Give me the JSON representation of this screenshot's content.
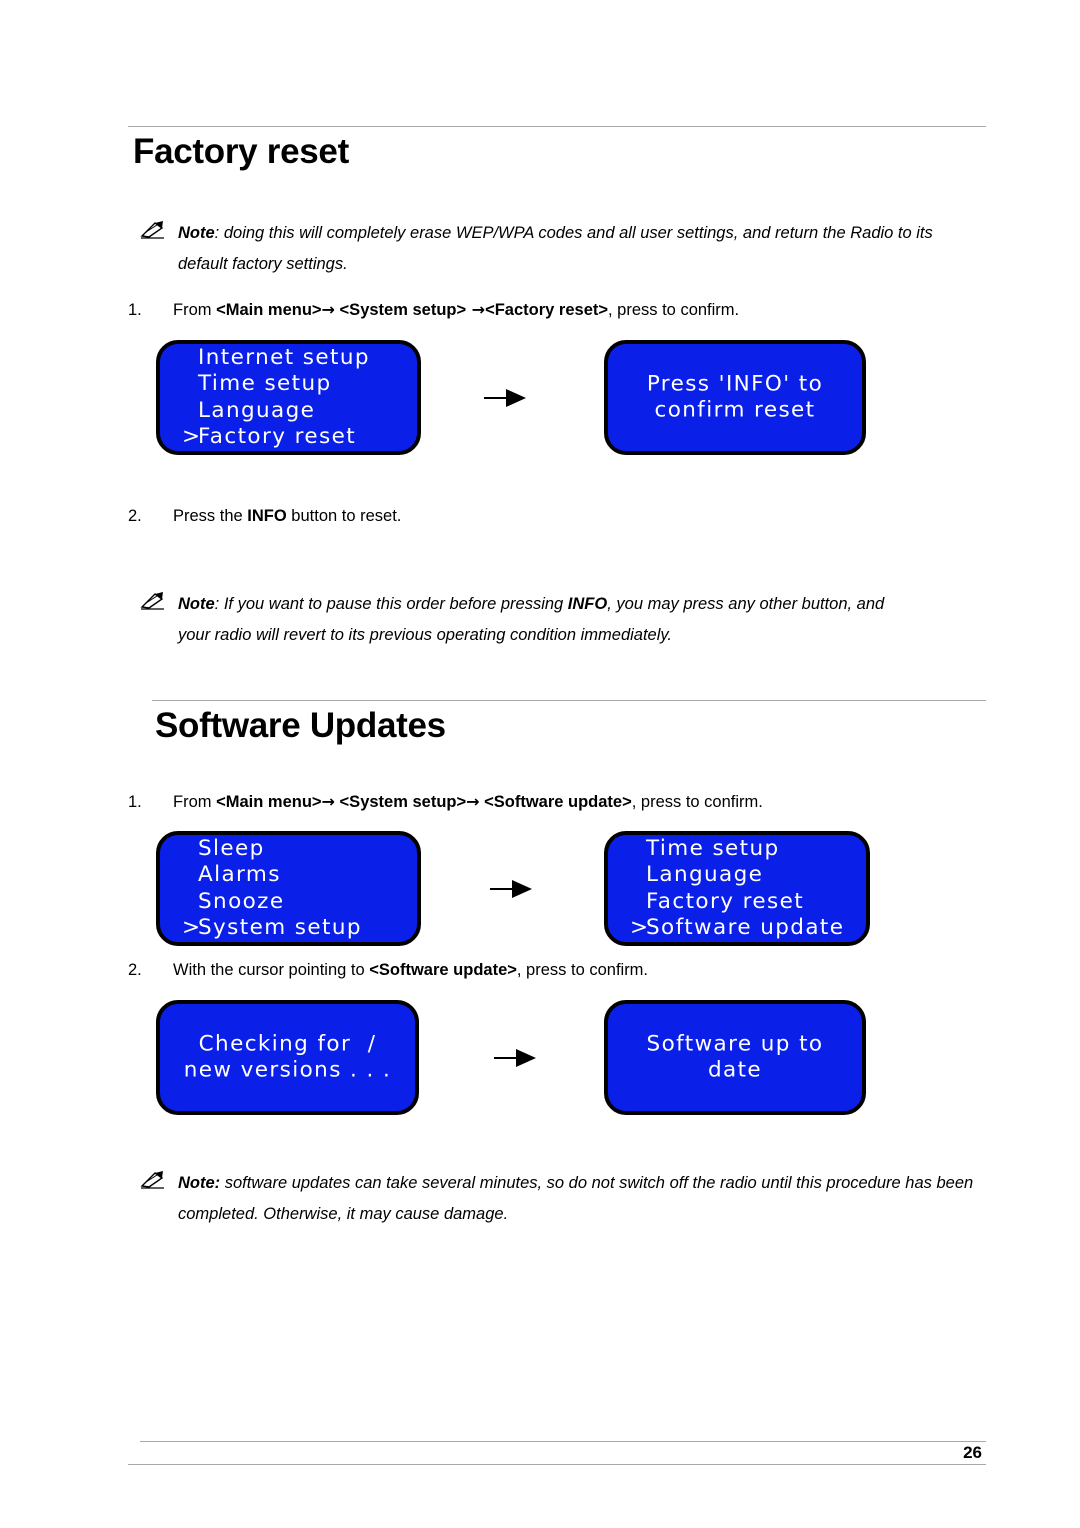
{
  "document": {
    "page_number": "26"
  },
  "sections": [
    {
      "id": "factory-reset",
      "title": "Factory reset",
      "note_top": {
        "icon": "note-pen-icon",
        "label": "Note",
        "separator": ":",
        "text": " doing this will completely erase WEP/WPA codes and all user settings, and return the Radio to its default factory settings."
      },
      "step1": {
        "number": "1.",
        "prefix": "From ",
        "item1": "<Main menu>",
        "arrow1": "→",
        "gap1": " ",
        "item2": "<System setup>",
        "arrow2": " →",
        "item3": "<Factory reset>",
        "suffix": ", press to confirm."
      },
      "step2": {
        "number": "2.",
        "prefix": "Press the ",
        "bold": "INFO",
        "suffix": " button to reset."
      },
      "note_bottom": {
        "icon": "note-pen-icon",
        "label": "Note",
        "separator": ":",
        "text_before": " If you want to pause this order before pressing ",
        "bold": "INFO",
        "text_after": ", you may press any other button, and your radio will revert to its previous operating condition immediately."
      }
    },
    {
      "id": "software-updates",
      "title": "Software Updates",
      "step1": {
        "number": "1.",
        "prefix": "From ",
        "item1": "<Main menu>",
        "arrow1": "→",
        "gap1": " ",
        "item2": "<System setup>",
        "arrow2": "→",
        "gap2": " ",
        "item3": "<Software update>",
        "suffix": ", press to confirm."
      },
      "step2": {
        "number": "2.",
        "prefix": "With the cursor pointing to ",
        "bold": "<Software update>",
        "suffix": ", press to confirm."
      },
      "note_bottom": {
        "icon": "note-pen-icon",
        "label": "Note:",
        "separator": "",
        "text": "  software updates can take several minutes, so do not switch off the radio until this procedure has been completed. Otherwise, it may cause damage."
      }
    }
  ],
  "lcd_screens": {
    "colors": {
      "background": "#0a1fe8",
      "border": "#000000",
      "text": "#ffffff"
    },
    "fr_menu": {
      "name": "system-setup-menu",
      "align": "left",
      "lines": [
        {
          "cursor": "",
          "text": "Internet setup"
        },
        {
          "cursor": "",
          "text": "Time setup"
        },
        {
          "cursor": "",
          "text": "Language"
        },
        {
          "cursor": ">",
          "text": "Factory reset"
        }
      ]
    },
    "fr_confirm": {
      "name": "confirm-reset-message",
      "align": "center",
      "lines": [
        {
          "cursor": "",
          "text": "Press 'INFO' to"
        },
        {
          "cursor": "",
          "text": "confirm reset"
        }
      ]
    },
    "su_main_menu": {
      "name": "main-menu",
      "align": "left",
      "lines": [
        {
          "cursor": "",
          "text": "Sleep"
        },
        {
          "cursor": "",
          "text": "Alarms"
        },
        {
          "cursor": "",
          "text": "Snooze"
        },
        {
          "cursor": ">",
          "text": "System setup"
        }
      ]
    },
    "su_system_menu": {
      "name": "system-setup-menu",
      "align": "left",
      "lines": [
        {
          "cursor": "",
          "text": "Time setup"
        },
        {
          "cursor": "",
          "text": "Language"
        },
        {
          "cursor": "",
          "text": "Factory reset"
        },
        {
          "cursor": ">",
          "text": "Software update"
        }
      ]
    },
    "su_checking": {
      "name": "checking-for-updates-message",
      "align": "center",
      "lines": [
        {
          "cursor": "",
          "text": "Checking for  /"
        },
        {
          "cursor": "",
          "text": "new versions . . ."
        }
      ]
    },
    "su_uptodate": {
      "name": "software-up-to-date-message",
      "align": "center",
      "lines": [
        {
          "cursor": "",
          "text": "Software up to"
        },
        {
          "cursor": "",
          "text": "date"
        }
      ]
    }
  }
}
